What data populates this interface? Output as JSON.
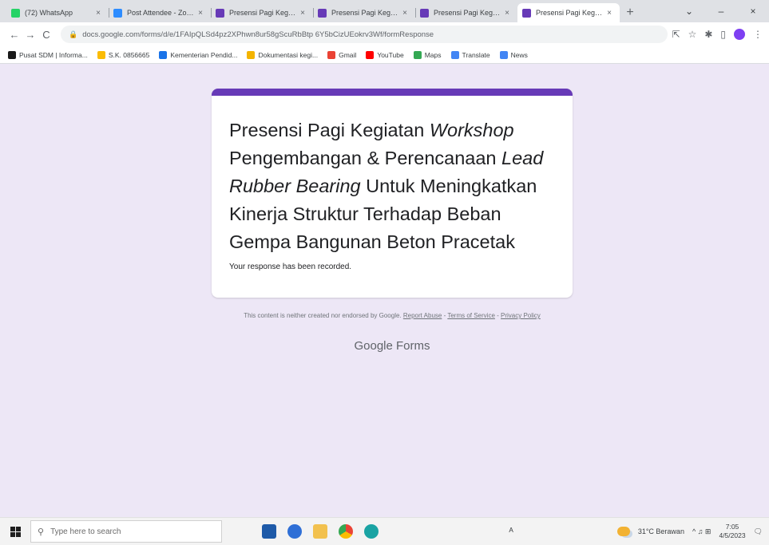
{
  "browser": {
    "tabs": [
      {
        "title": "(72) WhatsApp",
        "color": "#25d366"
      },
      {
        "title": "Post Attendee - Zoom",
        "color": "#2d8cff"
      },
      {
        "title": "Presensi Pagi Kegiatan",
        "color": "#673ab7"
      },
      {
        "title": "Presensi Pagi Kegiatan",
        "color": "#673ab7"
      },
      {
        "title": "Presensi Pagi Kegiatan",
        "color": "#673ab7"
      },
      {
        "title": "Presensi Pagi Kegiatan",
        "color": "#673ab7",
        "active": true
      }
    ],
    "close_glyph": "×",
    "new_tab_glyph": "+",
    "window_controls": [
      "⌄",
      "–",
      "×"
    ],
    "url": "docs.google.com/forms/d/e/1FAIpQLSd4pz2XPhwn8ur58gScuRbBtp 6Y5bCizUEokrv3Wf/formResponse",
    "bookmarks": [
      {
        "label": "Pusat SDM | Informa...",
        "color": "#1a1a1a"
      },
      {
        "label": "S.K. 0856665",
        "color": "#fbbc04"
      },
      {
        "label": "Kementerian Pendid...",
        "color": "#1a73e8"
      },
      {
        "label": "Dokumentasi kegi...",
        "color": "#f4b400"
      },
      {
        "label": "Gmail",
        "color": "#ea4335"
      },
      {
        "label": "YouTube",
        "color": "#ff0000"
      },
      {
        "label": "Maps",
        "color": "#34a853"
      },
      {
        "label": "Translate",
        "color": "#4285f4"
      },
      {
        "label": "News",
        "color": "#4285f4"
      }
    ]
  },
  "form": {
    "title_parts": [
      {
        "text": "Presensi Pagi Kegiatan ",
        "italic": false
      },
      {
        "text": "Workshop",
        "italic": true
      },
      {
        "text": " Pengembangan & Perencanaan ",
        "italic": false
      },
      {
        "text": "Lead Rubber Bearing",
        "italic": true
      },
      {
        "text": " Untuk Meningkatkan Kinerja Struktur Terhadap Beban Gempa Bangunan Beton Pracetak",
        "italic": false
      }
    ],
    "response_text": "Your response has been recorded.",
    "accent_color": "#673ab7"
  },
  "footer": {
    "disclaimer": "This content is neither created nor endorsed by Google.",
    "report_abuse": "Report Abuse",
    "terms": "Terms of Service",
    "privacy": "Privacy Policy",
    "separator": " - ",
    "brand": "Google Forms"
  },
  "taskbar": {
    "search_placeholder": "Type here to search",
    "weather": "31°C Berawan",
    "tray_icons": "^ ♫ ⊞",
    "time": "7:05",
    "date": "4/5/2023"
  }
}
